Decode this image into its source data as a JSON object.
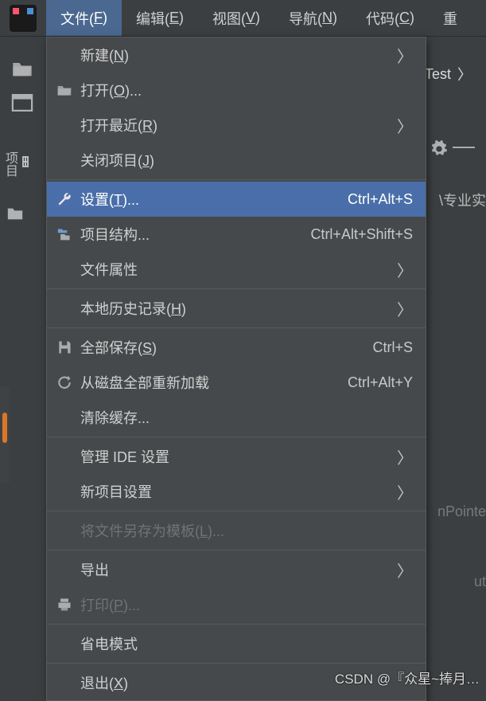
{
  "menubar": {
    "items": [
      {
        "label": "文件",
        "mnemonic": "F",
        "active": true
      },
      {
        "label": "编辑",
        "mnemonic": "E"
      },
      {
        "label": "视图",
        "mnemonic": "V"
      },
      {
        "label": "导航",
        "mnemonic": "N"
      },
      {
        "label": "代码",
        "mnemonic": "C"
      },
      {
        "label": "重",
        "mnemonic": ""
      }
    ]
  },
  "sidebar": {
    "project_label": "项目"
  },
  "right": {
    "test_label": "Test",
    "breadcrumb_frag": "\\专业实",
    "hint1": "nPointe",
    "hint2": "ut"
  },
  "dropdown": {
    "items": [
      {
        "icon": "",
        "label": "新建",
        "mnemonic": "N",
        "shortcut": "",
        "submenu": true
      },
      {
        "icon": "folder-open",
        "label": "打开",
        "mnemonic": "O",
        "suffix": "...",
        "shortcut": ""
      },
      {
        "icon": "",
        "label": "打开最近",
        "mnemonic": "R",
        "shortcut": "",
        "submenu": true
      },
      {
        "icon": "",
        "label": "关闭项目",
        "mnemonic": "J",
        "shortcut": ""
      },
      {
        "sep": true
      },
      {
        "icon": "wrench",
        "label": "设置",
        "mnemonic": "T",
        "suffix": "...",
        "shortcut": "Ctrl+Alt+S",
        "selected": true
      },
      {
        "icon": "project-structure",
        "label": "项目结构...",
        "mnemonic": "",
        "shortcut": "Ctrl+Alt+Shift+S"
      },
      {
        "icon": "",
        "label": "文件属性",
        "mnemonic": "",
        "shortcut": "",
        "submenu": true
      },
      {
        "sep": true
      },
      {
        "icon": "",
        "label": "本地历史记录",
        "mnemonic": "H",
        "shortcut": "",
        "submenu": true
      },
      {
        "sep": true
      },
      {
        "icon": "save",
        "label": "全部保存",
        "mnemonic": "S",
        "shortcut": "Ctrl+S"
      },
      {
        "icon": "reload",
        "label": "从磁盘全部重新加载",
        "mnemonic": "",
        "shortcut": "Ctrl+Alt+Y"
      },
      {
        "icon": "",
        "label": "清除缓存...",
        "mnemonic": "",
        "shortcut": ""
      },
      {
        "sep": true
      },
      {
        "icon": "",
        "label": "管理 IDE 设置",
        "mnemonic": "",
        "shortcut": "",
        "submenu": true
      },
      {
        "icon": "",
        "label": "新项目设置",
        "mnemonic": "",
        "shortcut": "",
        "submenu": true
      },
      {
        "sep": true
      },
      {
        "icon": "",
        "label": "将文件另存为模板",
        "mnemonic": "L",
        "suffix": "...",
        "shortcut": "",
        "disabled": true
      },
      {
        "sep": true
      },
      {
        "icon": "",
        "label": "导出",
        "mnemonic": "",
        "shortcut": "",
        "submenu": true
      },
      {
        "icon": "print",
        "label": "打印",
        "mnemonic": "P",
        "suffix": "...",
        "shortcut": "",
        "disabled": true
      },
      {
        "sep": true
      },
      {
        "icon": "",
        "label": "省电模式",
        "mnemonic": "",
        "shortcut": ""
      },
      {
        "sep": true
      },
      {
        "icon": "",
        "label": "退出",
        "mnemonic": "X",
        "shortcut": ""
      }
    ]
  },
  "watermark": "CSDN @『众星~捧月…"
}
